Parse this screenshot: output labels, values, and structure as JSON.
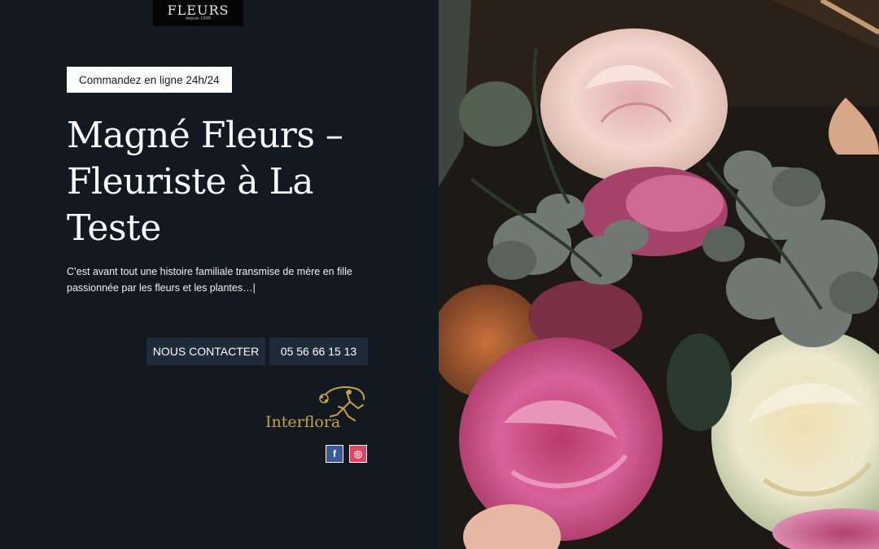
{
  "logo": {
    "text": "FLEURS",
    "subtitle": "depuis 1999"
  },
  "order_badge": "Commandez en ligne 24h/24",
  "hero": {
    "title": "Magné Fleurs – Fleuriste à La Teste",
    "text": "C’est avant tout une histoire familiale transmise de mère en fille passionnée par les fleurs et les plantes…|"
  },
  "buttons": {
    "contact": "NOUS CONTACTER",
    "phone": "05 56 66 15 13"
  },
  "partner": {
    "name": "Interflora"
  },
  "social": [
    {
      "icon": "facebook-icon",
      "glyph": "f",
      "color": "#3b5998"
    },
    {
      "icon": "instagram-icon",
      "glyph": "◎",
      "color": "#e4405f"
    }
  ],
  "colors": {
    "panel": "#121920",
    "button": "#1f2a3a",
    "gold": "#c9a23f"
  }
}
